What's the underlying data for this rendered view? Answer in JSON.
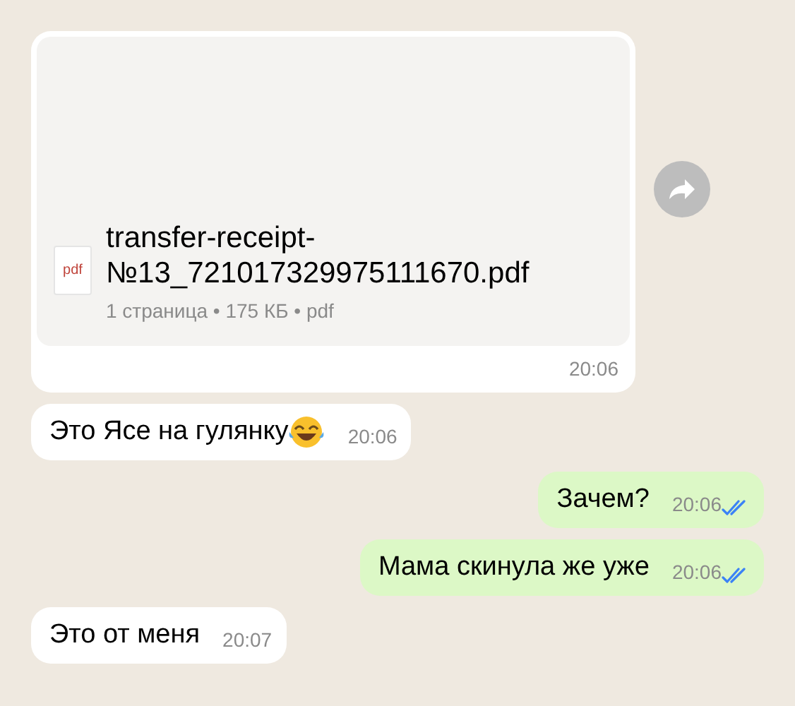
{
  "messages": [
    {
      "kind": "file",
      "outgoing": false,
      "file_type": "pdf",
      "file_name_lines": [
        "transfer-receipt-",
        "№13_721017329975111670.pdf"
      ],
      "file_info": "1 страница • 175 КБ • pdf",
      "time": "20:06",
      "forward": true
    },
    {
      "kind": "text",
      "outgoing": false,
      "text": "Это Ясе на гулянку",
      "laughing_emoji": true,
      "time": "20:06"
    },
    {
      "kind": "text",
      "outgoing": true,
      "text": "Зачем?",
      "time": "20:06",
      "read": true
    },
    {
      "kind": "text",
      "outgoing": true,
      "text": "Мама скинула же уже",
      "time": "20:06",
      "read": true
    },
    {
      "kind": "text",
      "outgoing": false,
      "text": "Это от меня",
      "time": "20:07"
    }
  ]
}
